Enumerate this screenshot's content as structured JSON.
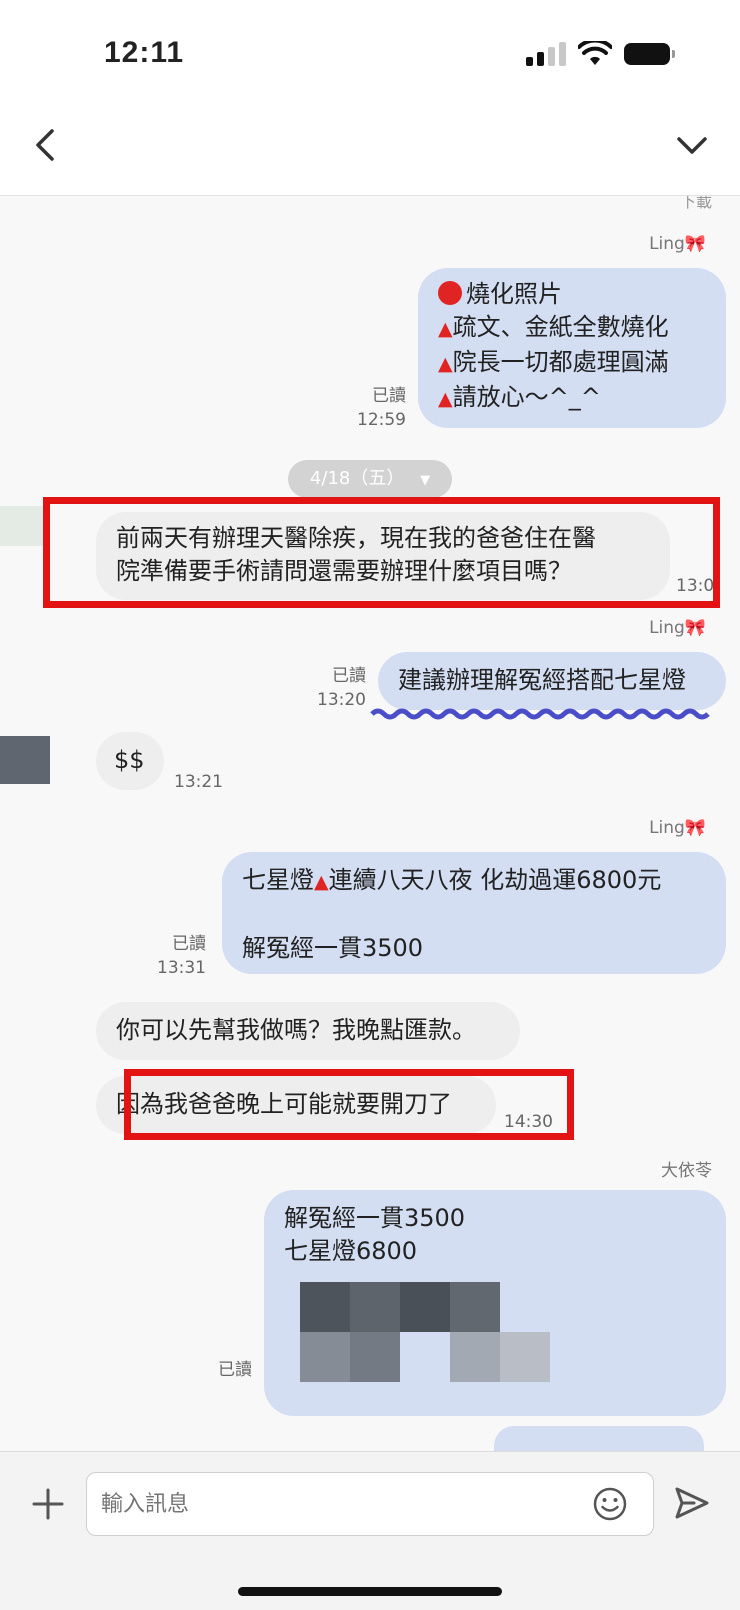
{
  "status_bar": {
    "time": "12:11"
  },
  "colors": {
    "outgoing_bubble": "#d4def2",
    "incoming_bubble": "#eeeeef",
    "highlight_box": "#e41313",
    "wavy_underline": "#4a4fc7"
  },
  "chat": {
    "top_partial_label": "下載",
    "date_pill": "4/18（五）",
    "messages": [
      {
        "id": "m1",
        "sender": "Ling🎀",
        "lines": [
          "燒化照片",
          "疏文、金紙全數燒化",
          "院長一切都處理圓滿",
          "請放心～^_^"
        ],
        "read": "已讀",
        "time": "12:59"
      },
      {
        "id": "m2",
        "lines": [
          "前兩天有辦理天醫除疾，現在我的爸爸住在醫",
          "院準備要手術請問還需要辦理什麼項目嗎？"
        ],
        "time": "13:0"
      },
      {
        "id": "m3",
        "sender": "Ling🎀",
        "lines": [
          "建議辦理解冤經搭配七星燈"
        ],
        "read": "已讀",
        "time": "13:20"
      },
      {
        "id": "m4",
        "lines": [
          "$$"
        ],
        "time": "13:21"
      },
      {
        "id": "m5",
        "sender": "Ling🎀",
        "lines": [
          "七星燈",
          "連續八天八夜  化劫過運6800元",
          "解冤經一貫3500"
        ],
        "read": "已讀",
        "time": "13:31"
      },
      {
        "id": "m6",
        "lines": [
          "你可以先幫我做嗎？我晚點匯款。"
        ]
      },
      {
        "id": "m7",
        "lines": [
          "因為我爸爸晚上可能就要開刀了"
        ],
        "time": "14:30"
      },
      {
        "id": "m8",
        "sender": "大依苓",
        "lines": [
          "解冤經一貫3500",
          "七星燈6800"
        ],
        "read": "已讀"
      }
    ]
  },
  "icons": {
    "back": "chevron-left-icon",
    "menu": "chevron-down-icon",
    "add": "plus-icon",
    "emoji": "smiley-icon",
    "send": "send-icon"
  },
  "input": {
    "placeholder": "輸入訊息"
  }
}
